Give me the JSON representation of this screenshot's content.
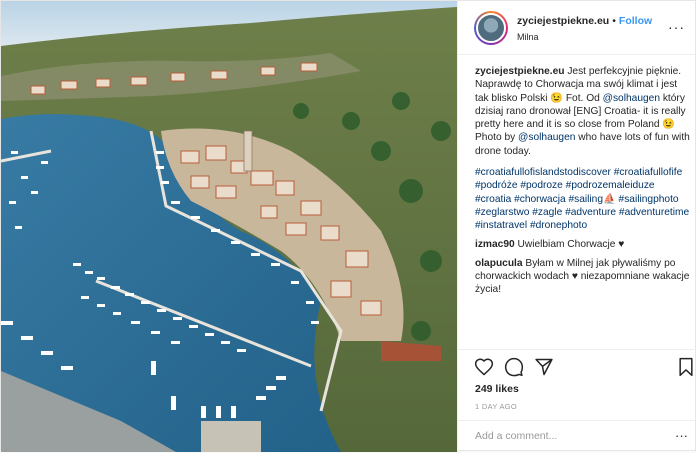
{
  "post": {
    "username": "zyciejestpiekne.eu",
    "follow_label": "Follow",
    "separator": "•",
    "location": "Milna",
    "more_label": "···"
  },
  "caption": {
    "username": "zyciejestpiekne.eu",
    "text_1": " Jest perfekcyjnie pięknie. Naprawdę to Chorwacja ma swój klimat i jest tak blisko Polski 😉 Fot. Od ",
    "mention_1": "@solhaugen",
    "text_2": " który dzisiaj rano dronował [ENG] Croatia- it is really pretty here and it is so close from Poland 😉 Photo by ",
    "mention_2": "@solhaugen",
    "text_3": " who have lots of fun with drone today.",
    "hashtags": [
      "#croatiafullofislandstodiscover",
      "#croatiafullofife",
      "#podróże",
      "#podroze",
      "#podrozemaleiduze",
      "#croatia",
      "#chorwacja",
      "#sailing⛵",
      "#sailingphoto",
      "#zeglarstwo",
      "#zagle",
      "#adventure",
      "#adventuretime",
      "#instatravel",
      "#dronephoto"
    ]
  },
  "comments": [
    {
      "user": "izmac90",
      "text": " Uwielbiam Chorwacje ♥"
    },
    {
      "user": "olapucula",
      "text": " Byłam w Milnej jak pływaliśmy po chorwackich wodach ♥ niezapomniane wakacje życia!"
    }
  ],
  "likes": "249 likes",
  "time": "1 DAY AGO",
  "add_comment_placeholder": "Add a comment...",
  "add_more_label": "···",
  "icons": {
    "like": "heart-icon",
    "comment": "comment-icon",
    "share": "share-icon",
    "save": "bookmark-icon"
  }
}
